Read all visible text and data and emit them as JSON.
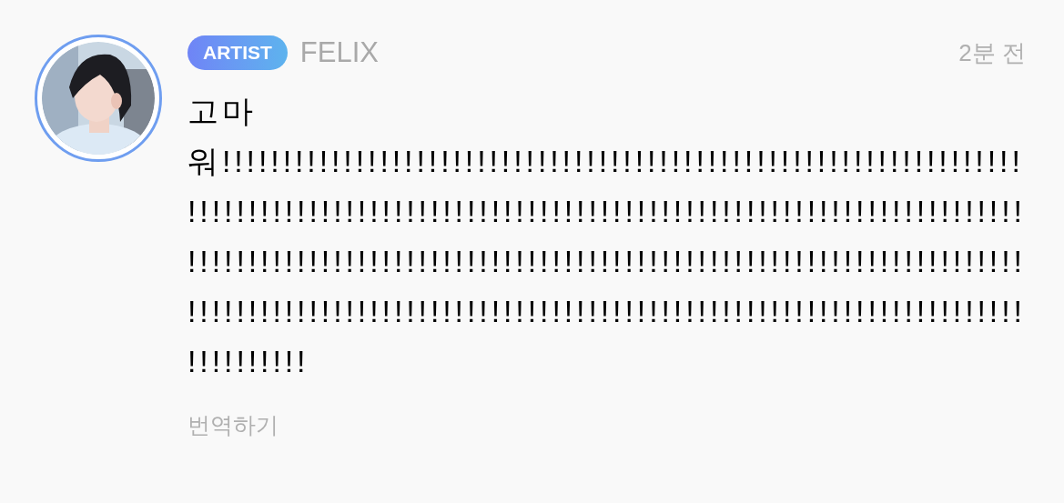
{
  "comment": {
    "badge": "ARTIST",
    "author": "FELIX",
    "time": "2분 전",
    "body": "고마워!!!!!!!!!!!!!!!!!!!!!!!!!!!!!!!!!!!!!!!!!!!!!!!!!!!!!!!!!!!!!!!!!!!!!!!!!!!!!!!!!!!!!!!!!!!!!!!!!!!!!!!!!!!!!!!!!!!!!!!!!!!!!!!!!!!!!!!!!!!!!!!!!!!!!!!!!!!!!!!!!!!!!!!!!!!!!!!!!!!!!!!!!!!!!!!!!!!!!!!!!!!!!!!!!!!!!!!!!!!!!!!!!!!!!!!!!!!!!!!!!!!!!!!!!!!!!!!!!!!!!!!!!!!!!!!!!!!!!!!!!!!",
    "translate": "번역하기"
  }
}
